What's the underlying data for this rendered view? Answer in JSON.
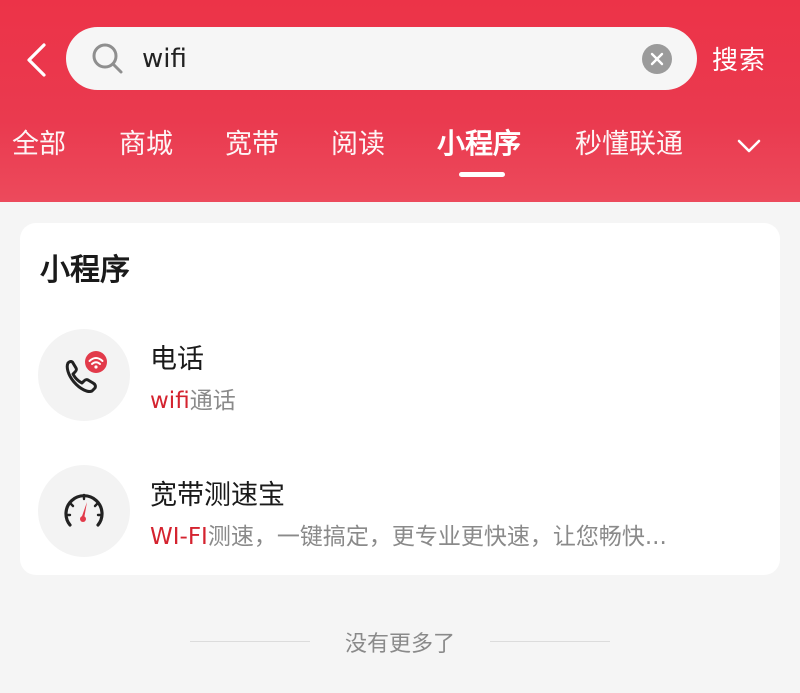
{
  "header": {
    "back_icon": "chevron-left-icon",
    "search": {
      "value": "wifi",
      "placeholder": ""
    },
    "search_label": "搜索",
    "tabs": [
      {
        "label": "全部"
      },
      {
        "label": "商城"
      },
      {
        "label": "宽带"
      },
      {
        "label": "阅读"
      },
      {
        "label": "小程序"
      },
      {
        "label": "秒懂联通"
      }
    ],
    "active_tab": "小程序"
  },
  "section": {
    "title": "小程序",
    "items": [
      {
        "name": "电话",
        "desc_highlight": "wifi",
        "desc_rest": "通话",
        "icon": "phone-wifi-icon"
      },
      {
        "name": "宽带测速宝",
        "desc_highlight": "WI-FI",
        "desc_rest": "测速，一键搞定，更专业更快速，让您畅快...",
        "icon": "speedometer-icon"
      }
    ]
  },
  "footer": {
    "text": "没有更多了"
  },
  "colors": {
    "header_red": "#ec3348",
    "highlight_red": "#d4232f",
    "background": "#f5f5f5"
  }
}
